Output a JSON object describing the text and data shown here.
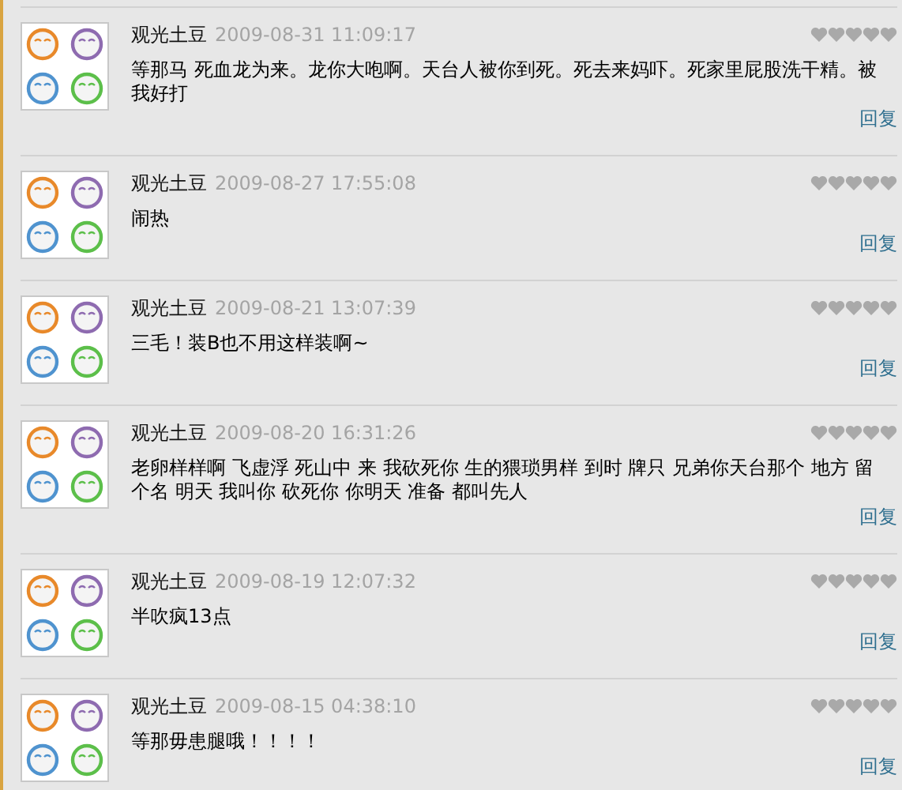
{
  "comments": [
    {
      "author": "观光土豆",
      "time": "2009-08-31 11:09:17",
      "stars": 0,
      "text": "等那马 死血龙为来。龙你大咆啊。天台人被你到死。死去来妈吓。死家里屁股洗干精。被我好打",
      "reply": "回复"
    },
    {
      "author": "观光土豆",
      "time": "2009-08-27 17:55:08",
      "stars": 0,
      "text": "闹热",
      "reply": "回复"
    },
    {
      "author": "观光土豆",
      "time": "2009-08-21 13:07:39",
      "stars": 0,
      "text": "三毛！装B也不用这样装啊~",
      "reply": "回复"
    },
    {
      "author": "观光土豆",
      "time": "2009-08-20 16:31:26",
      "stars": 0,
      "text": "老卵样样啊 飞虚浮 死山中 来 我砍死你 生的猥琐男样 到时 牌只 兄弟你天台那个 地方 留个名 明天 我叫你 砍死你 你明天 准备 都叫先人",
      "reply": "回复"
    },
    {
      "author": "观光土豆",
      "time": "2009-08-19 12:07:32",
      "stars": 0,
      "text": "半吹疯13点",
      "reply": "回复"
    },
    {
      "author": "观光土豆",
      "time": "2009-08-15 04:38:10",
      "stars": 0,
      "text": "等那毋患腿哦！！！！",
      "reply": "回复"
    }
  ]
}
